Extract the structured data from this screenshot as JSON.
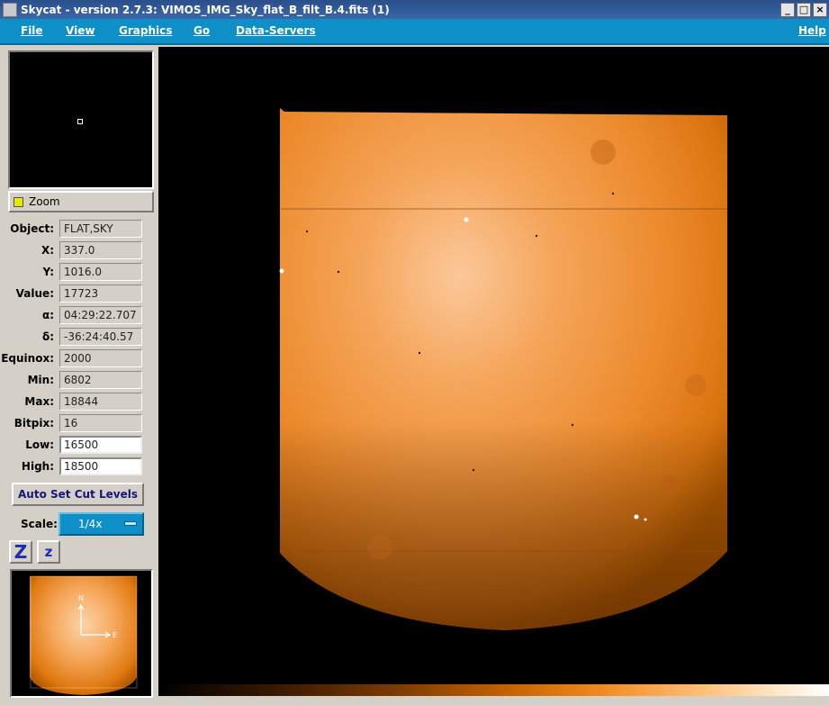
{
  "window": {
    "title": "Skycat - version 2.7.3: VIMOS_IMG_Sky_flat_B_filt_B.4.fits (1)",
    "min_glyph": "_",
    "max_glyph": "□",
    "close_glyph": "×"
  },
  "menubar": {
    "items": [
      "File",
      "View",
      "Graphics",
      "Go",
      "Data-Servers"
    ],
    "help": "Help"
  },
  "zoom": {
    "label": "Zoom",
    "checked": true
  },
  "info": {
    "object": {
      "label": "Object:",
      "value": "FLAT,SKY"
    },
    "x": {
      "label": "X:",
      "value": "337.0"
    },
    "y": {
      "label": "Y:",
      "value": "1016.0"
    },
    "value": {
      "label": "Value:",
      "value": "17723"
    },
    "alpha": {
      "label": "α:",
      "value": "04:29:22.707"
    },
    "delta": {
      "label": "δ:",
      "value": "-36:24:40.57"
    },
    "equinox": {
      "label": "Equinox:",
      "value": "2000"
    },
    "min": {
      "label": "Min:",
      "value": "6802"
    },
    "max": {
      "label": "Max:",
      "value": "18844"
    },
    "bitpix": {
      "label": "Bitpix:",
      "value": "16"
    },
    "low": {
      "label": "Low:",
      "value": "16500"
    },
    "high": {
      "label": "High:",
      "value": "18500"
    }
  },
  "auto_cut_label": "Auto Set Cut Levels",
  "scale": {
    "label": "Scale:",
    "value": "1/4x"
  },
  "zoom_buttons": {
    "zoom_in": "Z",
    "zoom_out": "z"
  },
  "compass": {
    "north": "N",
    "east": "E"
  },
  "colors": {
    "menubar": "#0f8fc7",
    "image_orange": "#f08a20",
    "label_blue": "#15157a"
  }
}
